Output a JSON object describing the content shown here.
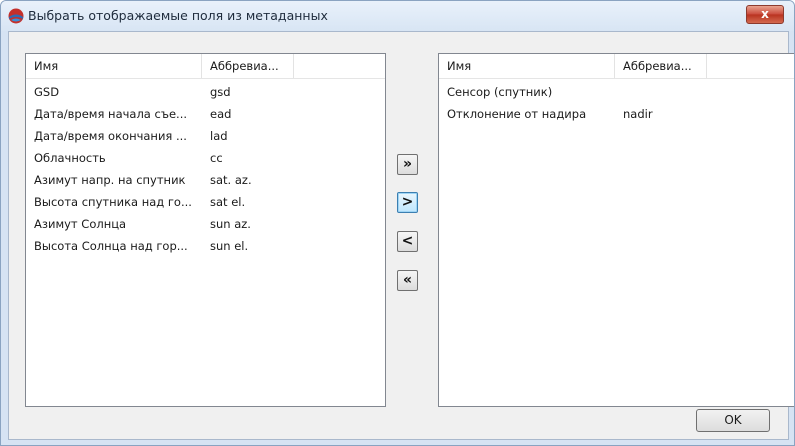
{
  "window": {
    "title": "Выбрать отображаемые поля из метаданных",
    "close_label": "x",
    "app_icon": "app-globe-icon"
  },
  "available_list": {
    "columns": [
      "Имя",
      "Аббревиа..."
    ],
    "rows": [
      {
        "name": "GSD",
        "abbr": "gsd"
      },
      {
        "name": "Дата/время начала съе...",
        "abbr": "ead"
      },
      {
        "name": "Дата/время окончания ...",
        "abbr": "lad"
      },
      {
        "name": "Облачность",
        "abbr": "cc"
      },
      {
        "name": "Азимут напр. на спутник",
        "abbr": "sat. az."
      },
      {
        "name": "Высота спутника над го...",
        "abbr": "sat el."
      },
      {
        "name": "Азимут Солнца",
        "abbr": "sun az."
      },
      {
        "name": "Высота Солнца над гор...",
        "abbr": "sun el."
      }
    ]
  },
  "selected_list": {
    "columns": [
      "Имя",
      "Аббревиа..."
    ],
    "rows": [
      {
        "name": "Сенсор (спутник)",
        "abbr": ""
      },
      {
        "name": "Отклонение от надира",
        "abbr": "nadir"
      }
    ]
  },
  "move_buttons": {
    "all_right": "»",
    "right": ">",
    "left": "<",
    "all_left": "«"
  },
  "ok_label": "OK"
}
